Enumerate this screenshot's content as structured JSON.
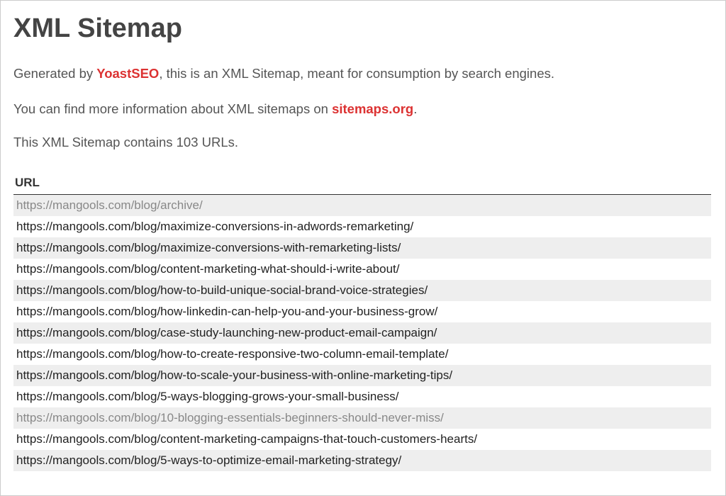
{
  "title": "XML Sitemap",
  "intro": {
    "prefix": "Generated by ",
    "link1_text": "YoastSEO",
    "middle": ", this is an XML Sitemap, meant for consumption by search engines.",
    "line2_prefix": "You can find more information about XML sitemaps on ",
    "link2_text": "sitemaps.org",
    "line2_suffix": "."
  },
  "count_line": "This XML Sitemap contains 103 URLs.",
  "table": {
    "header": "URL",
    "rows": [
      {
        "url": "https://mangools.com/blog/archive/",
        "muted": true
      },
      {
        "url": "https://mangools.com/blog/maximize-conversions-in-adwords-remarketing/",
        "muted": false
      },
      {
        "url": "https://mangools.com/blog/maximize-conversions-with-remarketing-lists/",
        "muted": false
      },
      {
        "url": "https://mangools.com/blog/content-marketing-what-should-i-write-about/",
        "muted": false
      },
      {
        "url": "https://mangools.com/blog/how-to-build-unique-social-brand-voice-strategies/",
        "muted": false
      },
      {
        "url": "https://mangools.com/blog/how-linkedin-can-help-you-and-your-business-grow/",
        "muted": false
      },
      {
        "url": "https://mangools.com/blog/case-study-launching-new-product-email-campaign/",
        "muted": false
      },
      {
        "url": "https://mangools.com/blog/how-to-create-responsive-two-column-email-template/",
        "muted": false
      },
      {
        "url": "https://mangools.com/blog/how-to-scale-your-business-with-online-marketing-tips/",
        "muted": false
      },
      {
        "url": "https://mangools.com/blog/5-ways-blogging-grows-your-small-business/",
        "muted": false
      },
      {
        "url": "https://mangools.com/blog/10-blogging-essentials-beginners-should-never-miss/",
        "muted": true
      },
      {
        "url": "https://mangools.com/blog/content-marketing-campaigns-that-touch-customers-hearts/",
        "muted": false
      },
      {
        "url": "https://mangools.com/blog/5-ways-to-optimize-email-marketing-strategy/",
        "muted": false
      }
    ]
  }
}
